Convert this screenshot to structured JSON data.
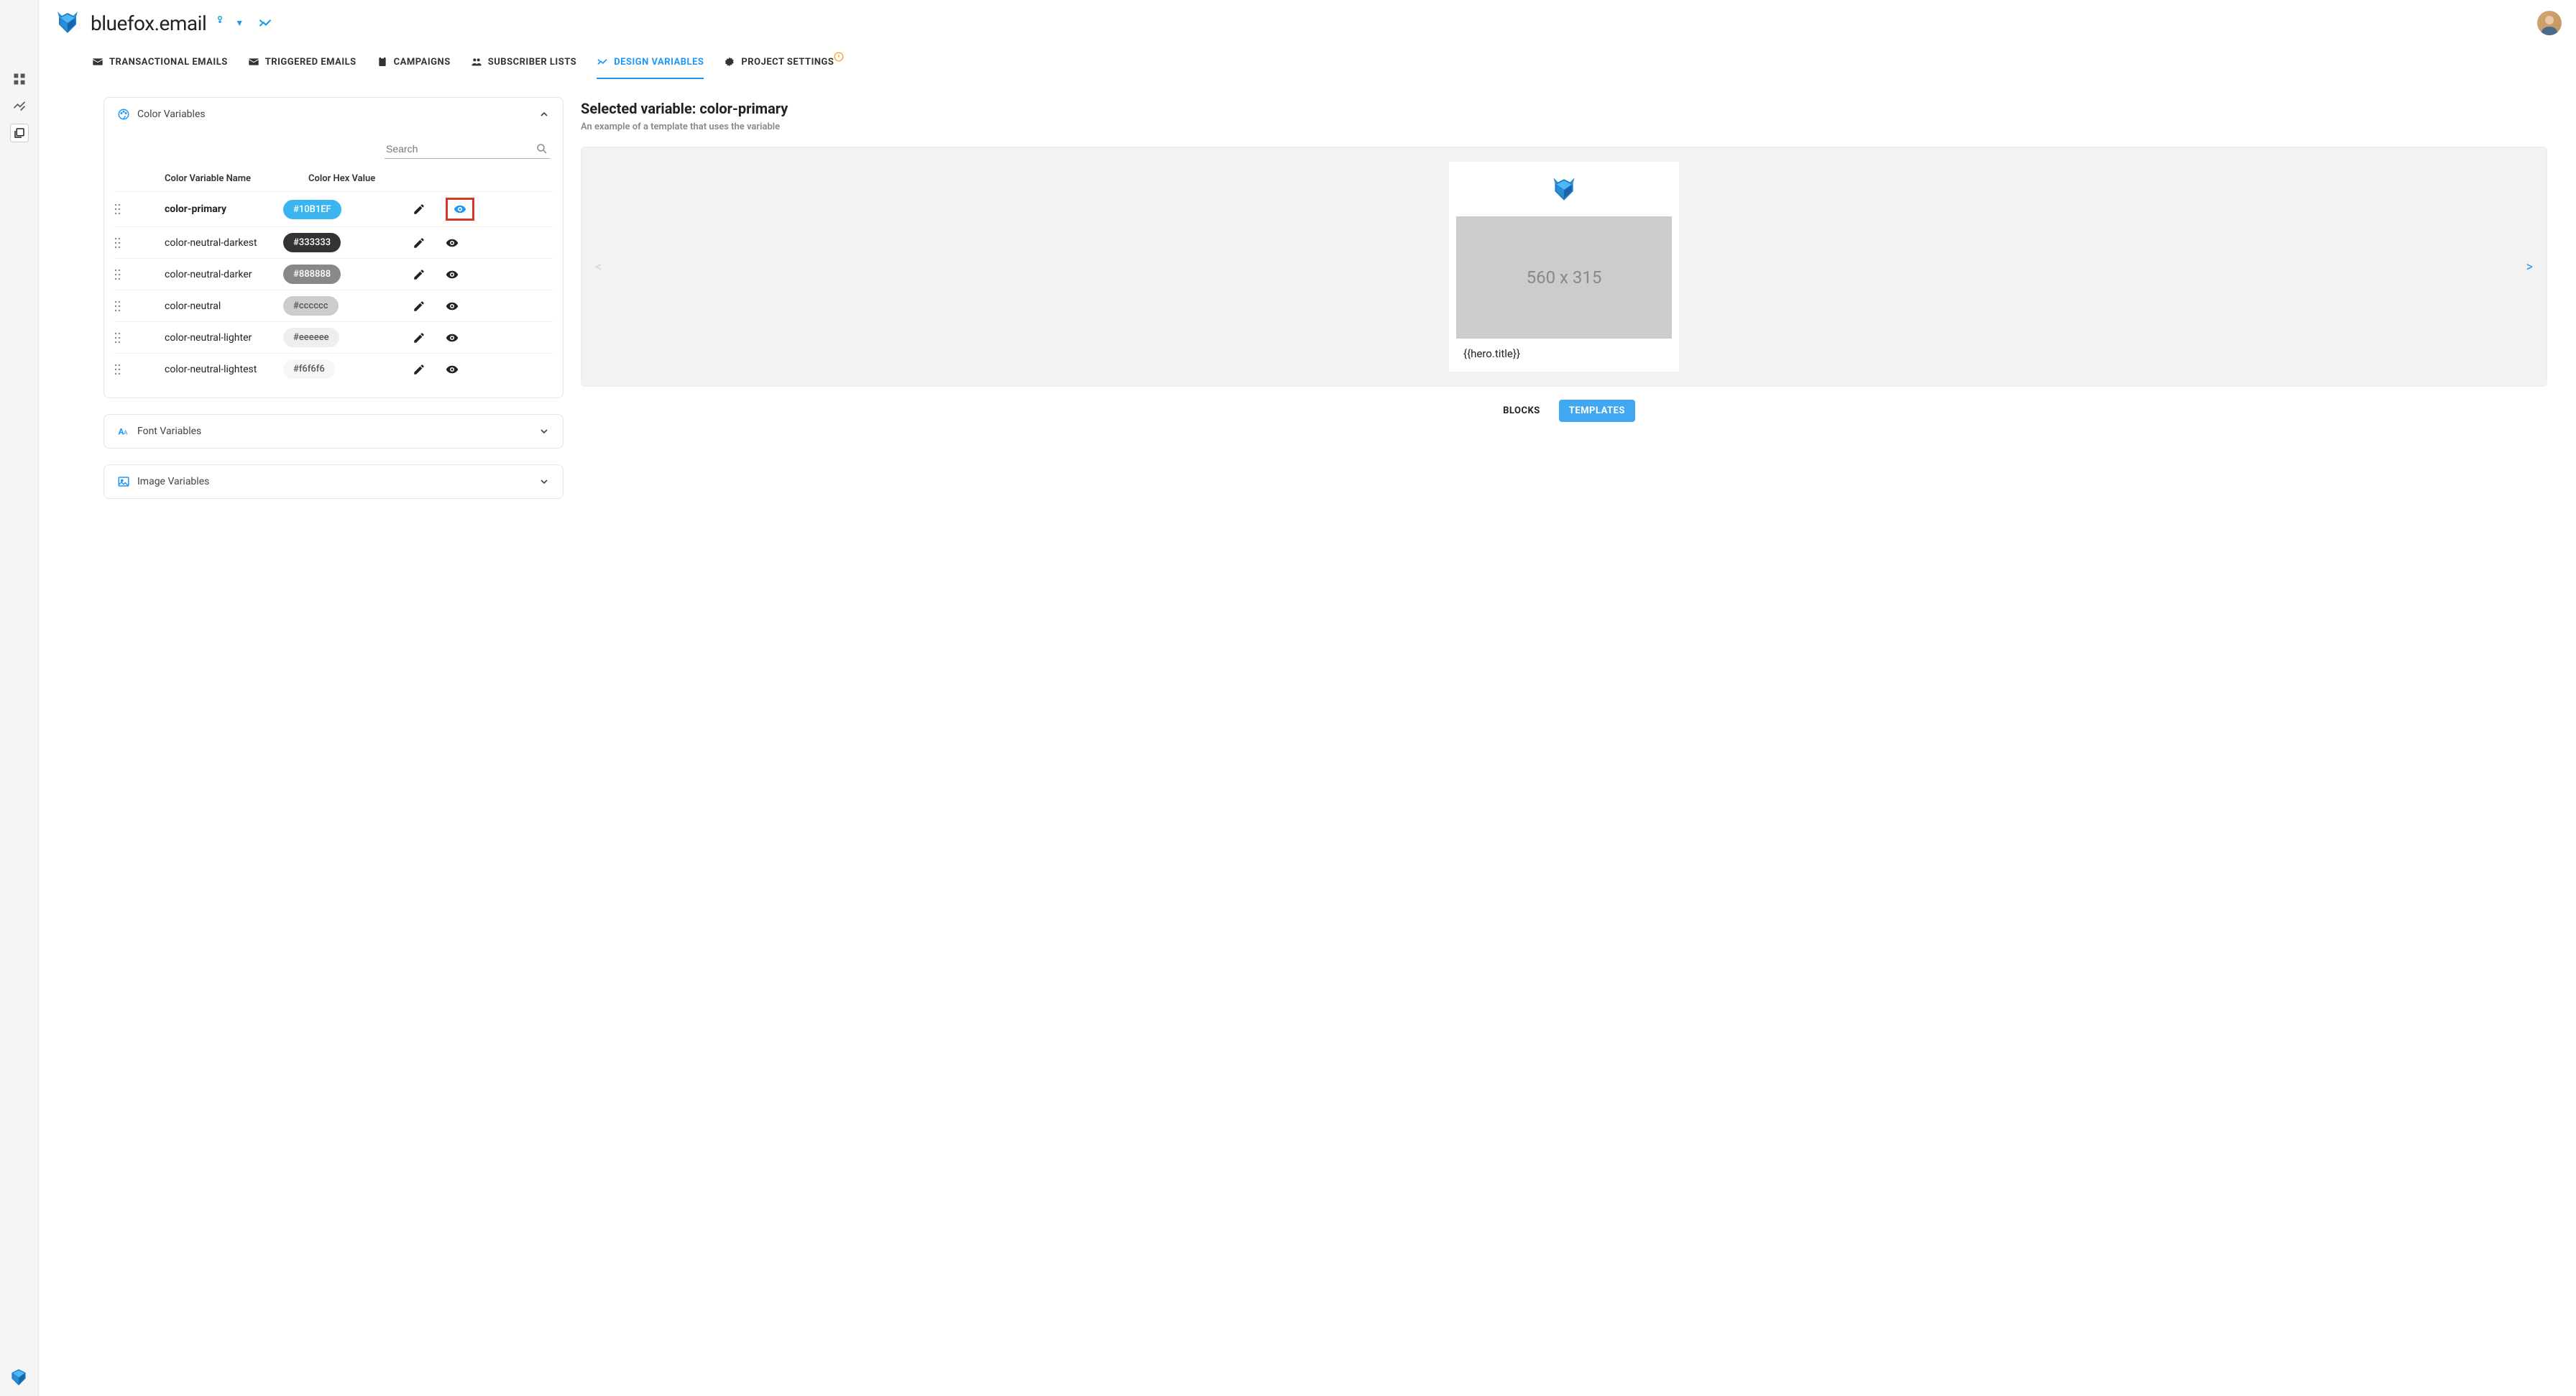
{
  "brand": "bluefox.email",
  "tabs": [
    {
      "label": "TRANSACTIONAL EMAILS",
      "icon": "mail"
    },
    {
      "label": "TRIGGERED EMAILS",
      "icon": "mail"
    },
    {
      "label": "CAMPAIGNS",
      "icon": "clipboard"
    },
    {
      "label": "SUBSCRIBER LISTS",
      "icon": "people"
    },
    {
      "label": "DESIGN VARIABLES",
      "icon": "tools",
      "active": true
    },
    {
      "label": "PROJECT SETTINGS",
      "icon": "gear",
      "warn": true
    }
  ],
  "search": {
    "placeholder": "Search"
  },
  "sections": {
    "color": {
      "title": "Color Variables",
      "headers": {
        "name": "Color Variable Name",
        "value": "Color Hex Value"
      }
    },
    "font": {
      "title": "Font Variables"
    },
    "image": {
      "title": "Image Variables"
    }
  },
  "colorVars": [
    {
      "name": "color-primary",
      "hex": "#10B1EF",
      "bg": "#3ab5ef",
      "fg": "#fff",
      "selected": true
    },
    {
      "name": "color-neutral-darkest",
      "hex": "#333333",
      "bg": "#333333",
      "fg": "#fff"
    },
    {
      "name": "color-neutral-darker",
      "hex": "#888888",
      "bg": "#888888",
      "fg": "#fff"
    },
    {
      "name": "color-neutral",
      "hex": "#cccccc",
      "bg": "#cccccc",
      "fg": "#555"
    },
    {
      "name": "color-neutral-lighter",
      "hex": "#eeeeee",
      "bg": "#eeeeee",
      "fg": "#555"
    },
    {
      "name": "color-neutral-lightest",
      "hex": "#f6f6f6",
      "bg": "#f6f6f6",
      "fg": "#555"
    }
  ],
  "selected": {
    "titlePrefix": "Selected variable: ",
    "name": "color-primary",
    "sub": "An example of a template that uses the variable"
  },
  "preview": {
    "placeholder": "560 x 315",
    "heroTitle": "{{hero.title}}"
  },
  "toggles": {
    "blocks": "BLOCKS",
    "templates": "TEMPLATES"
  }
}
